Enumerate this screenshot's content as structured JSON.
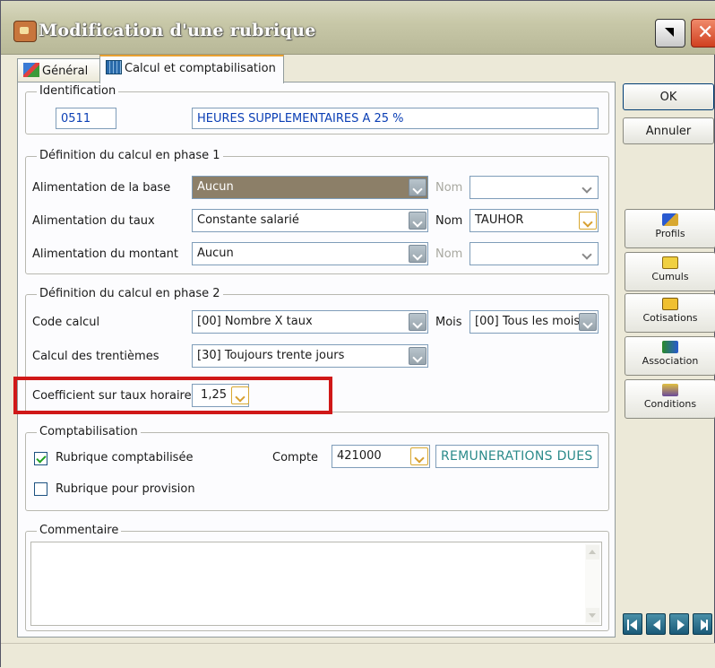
{
  "window": {
    "title": "Modification d'une rubrique"
  },
  "tabs": [
    {
      "label": "Général",
      "icon": "general-icon"
    },
    {
      "label": "Calcul et comptabilisation",
      "icon": "calc-icon"
    }
  ],
  "identification": {
    "legend": "Identification",
    "code": "0511",
    "libelle": "HEURES SUPPLEMENTAIRES A 25 %"
  },
  "phase1": {
    "legend": "Définition du calcul en phase 1",
    "rows": [
      {
        "label": "Alimentation de la base",
        "value": "Aucun",
        "nom_label": "Nom",
        "nom_value": ""
      },
      {
        "label": "Alimentation du taux",
        "value": "Constante salarié",
        "nom_label": "Nom",
        "nom_value": "TAUHOR"
      },
      {
        "label": "Alimentation du montant",
        "value": "Aucun",
        "nom_label": "Nom",
        "nom_value": ""
      }
    ]
  },
  "phase2": {
    "legend": "Définition du calcul en phase 2",
    "code_calcul_label": "Code calcul",
    "code_calcul_value": "[00]  Nombre X taux",
    "mois_label": "Mois",
    "mois_value": "[00] Tous les mois",
    "trentiemes_label": "Calcul des trentièmes",
    "trentiemes_value": "[30]  Toujours trente jours",
    "coef_label": "Coefficient sur taux horaire",
    "coef_value": "1,25"
  },
  "comptabilisation": {
    "legend": "Comptabilisation",
    "rubrique_comptabilisee": "Rubrique comptabilisée",
    "rubrique_comptabilisee_checked": true,
    "compte_label": "Compte",
    "compte_value": "421000",
    "compte_libelle": "REMUNERATIONS DUES",
    "rubrique_provision": "Rubrique pour provision",
    "rubrique_provision_checked": false
  },
  "commentaire": {
    "legend": "Commentaire",
    "value": ""
  },
  "buttons": {
    "ok": "OK",
    "annuler": "Annuler"
  },
  "side_buttons": [
    {
      "label": "Profils",
      "icon": "profils-icon"
    },
    {
      "label": "Cumuls",
      "icon": "cumuls-icon"
    },
    {
      "label": "Cotisations",
      "icon": "cotisations-icon"
    },
    {
      "label": "Association",
      "icon": "association-icon"
    },
    {
      "label": "Conditions",
      "icon": "conditions-icon"
    }
  ],
  "colors": {
    "highlight": "#d01818",
    "link_blue": "#0b3fb5",
    "teal_text": "#2a8a8a"
  }
}
